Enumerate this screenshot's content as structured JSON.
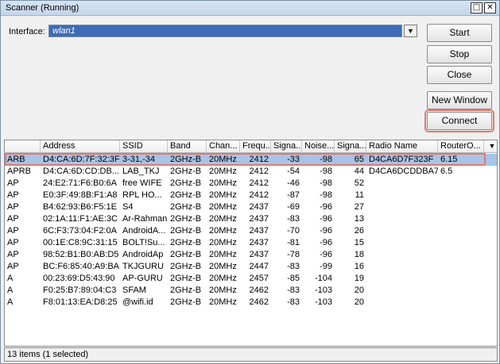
{
  "window": {
    "title": "Scanner (Running)"
  },
  "interface": {
    "label": "Interface:",
    "value": "wlan1"
  },
  "buttons": {
    "start": "Start",
    "stop": "Stop",
    "close": "Close",
    "new_window": "New Window",
    "connect": "Connect"
  },
  "table": {
    "columns": [
      "",
      "Address",
      "SSID",
      "Band",
      "Chan...",
      "Frequ...",
      "Signa...",
      "Noise...",
      "Signa...",
      "Radio Name",
      "RouterO..."
    ],
    "rows": [
      [
        "ARB",
        "D4:CA:6D:7F:32:3F",
        "3-31,-34",
        "2GHz-B",
        "20MHz",
        "2412",
        "-33",
        "-98",
        "65",
        "D4CA6D7F323F",
        "6.15"
      ],
      [
        "APRB",
        "D4:CA:6D:CD:DB...",
        "LAB_TKJ",
        "2GHz-B",
        "20MHz",
        "2412",
        "-54",
        "-98",
        "44",
        "D4CA6DCDDBA7",
        "6.5"
      ],
      [
        "AP",
        "24:E2:71:F6:B0:6A",
        "free WIFE",
        "2GHz-B",
        "20MHz",
        "2412",
        "-46",
        "-98",
        "52",
        "",
        ""
      ],
      [
        "AP",
        "E0:3F:49:8B:F1:A8",
        "RPL HO...",
        "2GHz-B",
        "20MHz",
        "2412",
        "-87",
        "-98",
        "11",
        "",
        ""
      ],
      [
        "AP",
        "B4:62:93:B6:F5:1E",
        "S4",
        "2GHz-B",
        "20MHz",
        "2437",
        "-69",
        "-96",
        "27",
        "",
        ""
      ],
      [
        "AP",
        "02:1A:11:F1:AE:3C",
        "Ar-Rahman",
        "2GHz-B",
        "20MHz",
        "2437",
        "-83",
        "-96",
        "13",
        "",
        ""
      ],
      [
        "AP",
        "6C:F3:73:04:F2:0A",
        "AndroidA...",
        "2GHz-B",
        "20MHz",
        "2437",
        "-70",
        "-96",
        "26",
        "",
        ""
      ],
      [
        "AP",
        "00:1E:C8:9C:31:15",
        "BOLT!Su...",
        "2GHz-B",
        "20MHz",
        "2437",
        "-81",
        "-96",
        "15",
        "",
        ""
      ],
      [
        "AP",
        "98:52:B1:B0:AB:D5",
        "AndroidAp",
        "2GHz-B",
        "20MHz",
        "2437",
        "-78",
        "-96",
        "18",
        "",
        ""
      ],
      [
        "AP",
        "BC:F6:85:40:A9:BA",
        "TKJGURU",
        "2GHz-B",
        "20MHz",
        "2447",
        "-83",
        "-99",
        "16",
        "",
        ""
      ],
      [
        "A",
        "00:23:69:D5:43:90",
        "AP-GURU",
        "2GHz-B",
        "20MHz",
        "2457",
        "-85",
        "-104",
        "19",
        "",
        ""
      ],
      [
        "A",
        "F0:25:B7:89:04:C3",
        "SFAM",
        "2GHz-B",
        "20MHz",
        "2462",
        "-83",
        "-103",
        "20",
        "",
        ""
      ],
      [
        "A",
        "F8:01:13:EA:D8:25",
        "@wifi.id",
        "2GHz-B",
        "20MHz",
        "2462",
        "-83",
        "-103",
        "20",
        "",
        ""
      ]
    ],
    "selected_index": 0
  },
  "status": {
    "text": "13 items (1 selected)"
  },
  "icons": {
    "maximize": "maximize-icon",
    "close": "close-icon",
    "dropdown": "chevron-down-icon",
    "column_menu": "column-menu-icon"
  }
}
